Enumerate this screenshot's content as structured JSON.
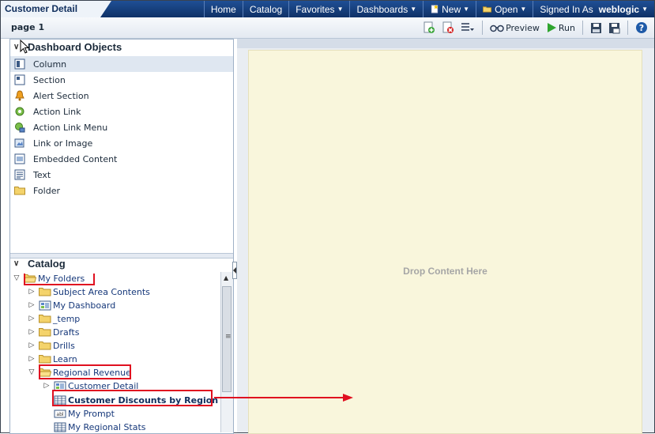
{
  "header": {
    "title": "Customer Detail",
    "nav": [
      {
        "label": "Home",
        "caret": false
      },
      {
        "label": "Catalog",
        "caret": false
      },
      {
        "label": "Favorites",
        "caret": true
      },
      {
        "label": "Dashboards",
        "caret": true
      },
      {
        "label": "New",
        "caret": true
      },
      {
        "label": "Open",
        "caret": true
      }
    ],
    "signed_in_label": "Signed In As",
    "user": "weblogic"
  },
  "toolbar": {
    "page_label": "page 1",
    "preview_label": "Preview",
    "run_label": "Run"
  },
  "dashboard_objects": {
    "heading": "Dashboard Objects",
    "items": [
      {
        "label": "Column",
        "icon": "column-icon",
        "selected": true
      },
      {
        "label": "Section",
        "icon": "section-icon"
      },
      {
        "label": "Alert Section",
        "icon": "alert-bell-icon"
      },
      {
        "label": "Action Link",
        "icon": "action-link-icon"
      },
      {
        "label": "Action Link Menu",
        "icon": "action-link-menu-icon"
      },
      {
        "label": "Link or Image",
        "icon": "link-image-icon"
      },
      {
        "label": "Embedded Content",
        "icon": "embedded-content-icon"
      },
      {
        "label": "Text",
        "icon": "text-icon"
      },
      {
        "label": "Folder",
        "icon": "folder-icon"
      }
    ]
  },
  "catalog": {
    "heading": "Catalog",
    "tree": [
      {
        "label": "My Folders",
        "icon": "folder-open-icon",
        "expanded": true,
        "highlighted": true
      },
      {
        "label": "Subject Area Contents",
        "icon": "folder-icon"
      },
      {
        "label": "My Dashboard",
        "icon": "dashboard-icon"
      },
      {
        "label": "_temp",
        "icon": "folder-icon"
      },
      {
        "label": "Drafts",
        "icon": "folder-icon"
      },
      {
        "label": "Drills",
        "icon": "folder-icon"
      },
      {
        "label": "Learn",
        "icon": "folder-icon"
      },
      {
        "label": "Regional Revenue",
        "icon": "folder-open-icon",
        "expanded": true,
        "highlighted": true
      },
      {
        "label": "Customer Detail",
        "icon": "dashboard-icon"
      },
      {
        "label": "Customer Discounts by Region",
        "icon": "table-icon",
        "highlighted": true,
        "bold": true
      },
      {
        "label": "My Prompt",
        "icon": "prompt-icon"
      },
      {
        "label": "My Regional Stats",
        "icon": "table-icon"
      }
    ]
  },
  "drop_area": {
    "text": "Drop Content Here"
  },
  "colors": {
    "header_blue": "#133a76",
    "highlight_red": "#e01020",
    "drop_bg": "#f9f6dc"
  }
}
